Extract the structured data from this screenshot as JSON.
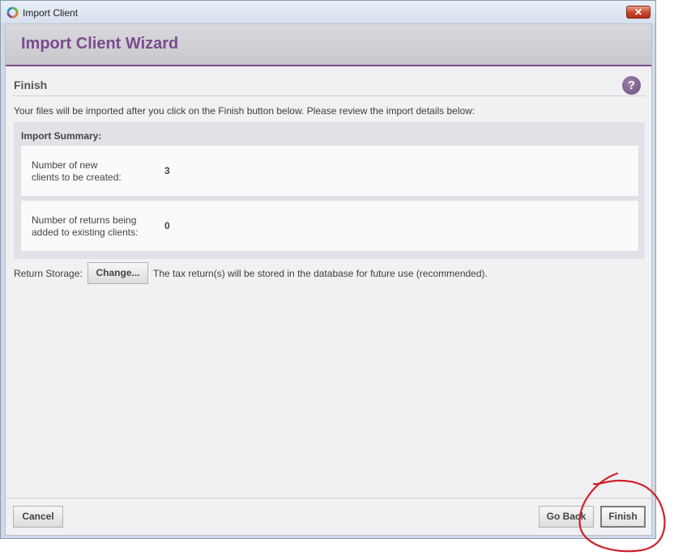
{
  "window": {
    "title": "Import Client",
    "close_label": "✕"
  },
  "wizard": {
    "title": "Import Client Wizard"
  },
  "section": {
    "title": "Finish",
    "help_label": "?",
    "intro": "Your files will be imported after you click on the Finish button below. Please review the import details below:"
  },
  "summary": {
    "title": "Import Summary:",
    "rows": [
      {
        "label_line1": "Number of new",
        "label_line2": "clients to be created:",
        "value": "3"
      },
      {
        "label_line1": "Number of returns being",
        "label_line2": "added to existing clients:",
        "value": "0"
      }
    ]
  },
  "storage": {
    "label": "Return Storage:",
    "button_label": "Change...",
    "description": "The tax return(s) will be stored in the database for future use (recommended)."
  },
  "footer": {
    "cancel_label": "Cancel",
    "back_label": "Go Back",
    "finish_label": "Finish"
  },
  "icons": {
    "app": "app-logo-icon",
    "help": "help-icon",
    "close": "close-icon"
  },
  "colors": {
    "accent": "#7b4b8c",
    "annotation": "#d0202a"
  }
}
